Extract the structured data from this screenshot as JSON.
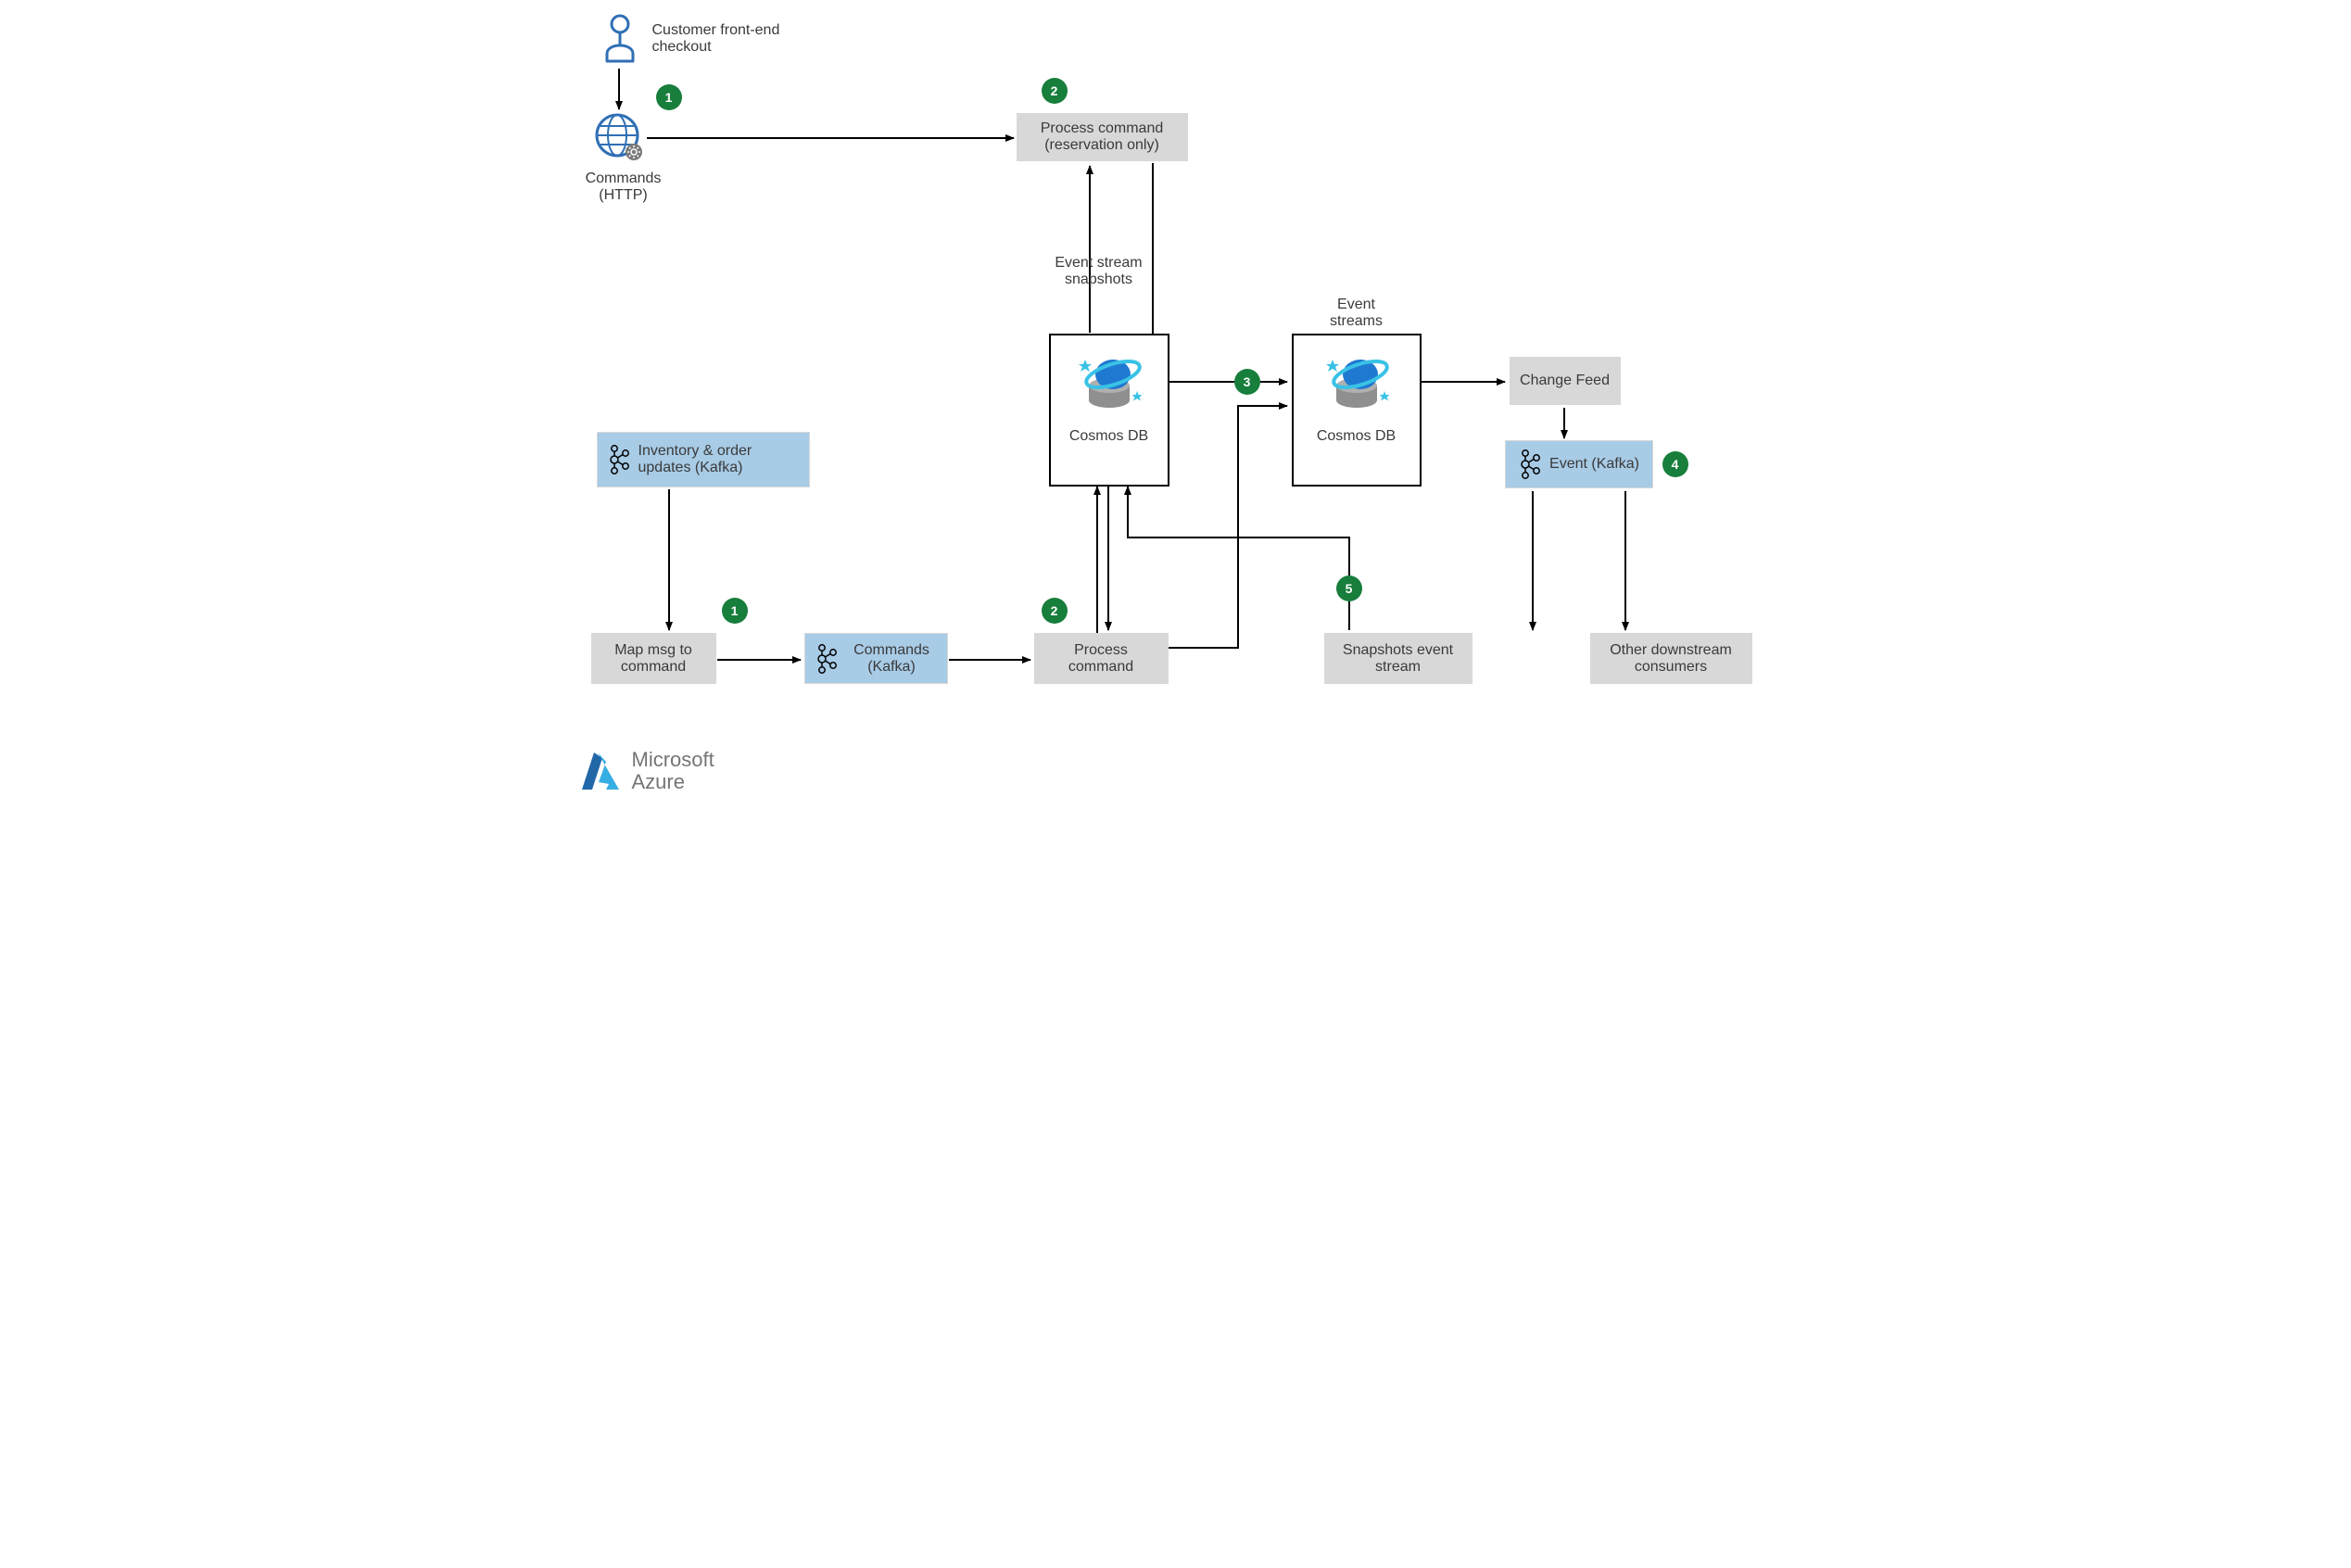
{
  "labels": {
    "customer_frontend": "Customer front-end checkout",
    "commands_http": "Commands (HTTP)",
    "process_command_reservation": "Process command (reservation only)",
    "event_stream_snapshots": "Event stream snapshots",
    "event_streams": "Event streams",
    "cosmos_db": "Cosmos DB",
    "change_feed": "Change Feed",
    "event_kafka": "Event (Kafka)",
    "inventory_updates": "Inventory & order updates (Kafka)",
    "map_msg": "Map msg to command",
    "commands_kafka": "Commands (Kafka)",
    "process_command": "Process command",
    "snapshots_event_stream": "Snapshots event stream",
    "other_consumers": "Other downstream consumers",
    "microsoft": "Microsoft",
    "azure": "Azure"
  },
  "badges": {
    "b1a": "1",
    "b1b": "1",
    "b2a": "2",
    "b2b": "2",
    "b3": "3",
    "b4": "4",
    "b5": "5"
  },
  "colors": {
    "badge": "#177e3b",
    "grey_box": "#d8d8d8",
    "blue_box": "#a8cbe6",
    "azure_blue_dark": "#2267a8",
    "azure_blue_light": "#37aee3"
  }
}
